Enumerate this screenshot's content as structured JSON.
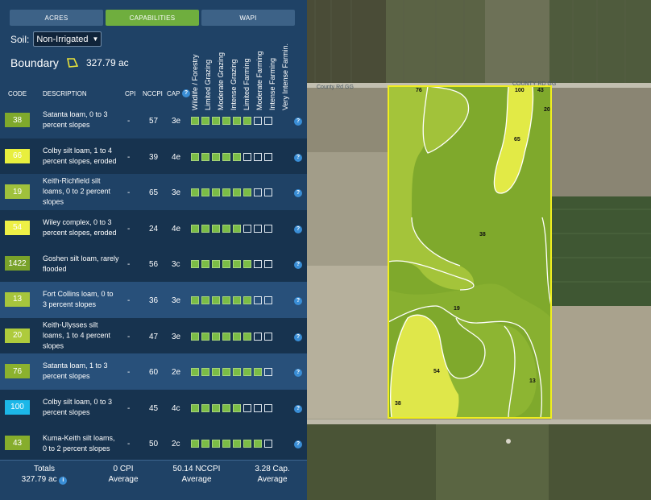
{
  "tabs": [
    {
      "label": "ACRES",
      "active": false
    },
    {
      "label": "CAPABILITIES",
      "active": true
    },
    {
      "label": "WAPI",
      "active": false
    }
  ],
  "soil": {
    "label": "Soil:",
    "selected": "Non-Irrigated"
  },
  "boundary": {
    "label": "Boundary",
    "value": "327.79 ac",
    "icon": "polygon-icon"
  },
  "columns": {
    "code": "CODE",
    "description": "DESCRIPTION",
    "cpi": "CPI",
    "nccpi": "NCCPI",
    "cap": "CAP",
    "capability_classes": [
      "Wildlife / Forestry",
      "Limited Grazing",
      "Moderate Grazing",
      "Intense Grazing",
      "Limited Farming",
      "Moderate Farming",
      "Intense Farming",
      "Very Intense Farmin."
    ]
  },
  "rows": [
    {
      "code": "38",
      "color": "#7fa92c",
      "description": "Satanta loam, 0 to 3 percent slopes",
      "cpi": "-",
      "nccpi": "57",
      "cap": "3e",
      "filled": 6
    },
    {
      "code": "66",
      "color": "#e8ef3e",
      "description": "Colby silt loam, 1 to 4 percent slopes, eroded",
      "cpi": "-",
      "nccpi": "39",
      "cap": "4e",
      "filled": 5
    },
    {
      "code": "19",
      "color": "#9fc13c",
      "description": "Keith-Richfield silt loams, 0 to 2 percent slopes",
      "cpi": "-",
      "nccpi": "65",
      "cap": "3e",
      "filled": 6
    },
    {
      "code": "54",
      "color": "#eef046",
      "description": "Wiley complex, 0 to 3 percent slopes, eroded",
      "cpi": "-",
      "nccpi": "24",
      "cap": "4e",
      "filled": 5
    },
    {
      "code": "1422",
      "color": "#79a22a",
      "description": "Goshen silt loam, rarely flooded",
      "cpi": "-",
      "nccpi": "56",
      "cap": "3c",
      "filled": 6
    },
    {
      "code": "13",
      "color": "#a6c53c",
      "description": "Fort Collins loam, 0 to 3 percent slopes",
      "cpi": "-",
      "nccpi": "36",
      "cap": "3e",
      "filled": 6
    },
    {
      "code": "20",
      "color": "#aecb3c",
      "description": "Keith-Ulysses silt loams, 1 to 4 percent slopes",
      "cpi": "-",
      "nccpi": "47",
      "cap": "3e",
      "filled": 6
    },
    {
      "code": "76",
      "color": "#8bb22e",
      "description": "Satanta loam, 1 to 3 percent slopes",
      "cpi": "-",
      "nccpi": "60",
      "cap": "2e",
      "filled": 7
    },
    {
      "code": "100",
      "color": "#1cb7e8",
      "description": "Colby silt loam, 0 to 3 percent slopes",
      "cpi": "-",
      "nccpi": "45",
      "cap": "4c",
      "filled": 5
    },
    {
      "code": "43",
      "color": "#86ad2c",
      "description": "Kuma-Keith silt loams, 0 to 2 percent slopes",
      "cpi": "-",
      "nccpi": "50",
      "cap": "2c",
      "filled": 7
    }
  ],
  "totals": {
    "label": "Totals",
    "acres": "327.79 ac",
    "cpi": "0 CPI",
    "cpi_sub": "Average",
    "nccpi": "50.14 NCCPI",
    "nccpi_sub": "Average",
    "cap": "3.28 Cap.",
    "cap_sub": "Average"
  },
  "map": {
    "roads": [
      "County Rd GG",
      "COUNTY RD GG"
    ],
    "labels": [
      "76",
      "100",
      "43",
      "20",
      "65",
      "38",
      "19",
      "54",
      "13",
      "38"
    ]
  }
}
